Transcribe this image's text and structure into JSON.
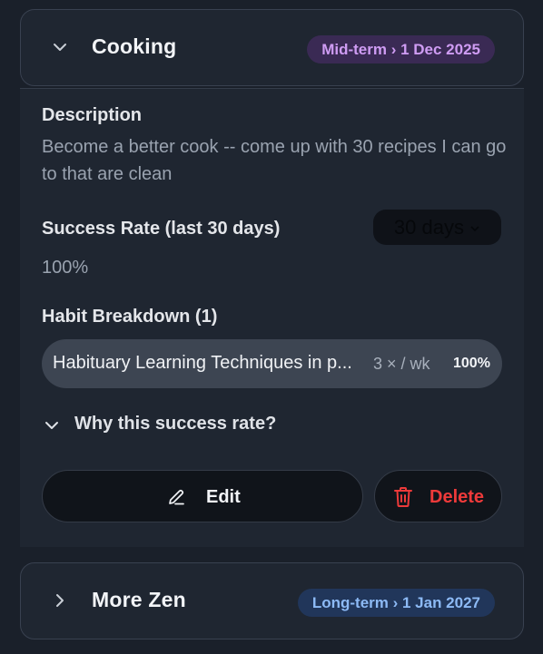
{
  "goals": [
    {
      "title": "Cooking",
      "expanded": true,
      "badge": "Mid-term › 1 Dec 2025",
      "description_label": "Description",
      "description": "Become a better cook -- come up with 30 recipes I can go to that are clean",
      "success_rate_label": "Success Rate (last 30 days)",
      "range_select": "30 days",
      "success_rate": "100%",
      "habit_breakdown_label": "Habit Breakdown (1)",
      "habits": [
        {
          "name": "Habituary Learning Techniques in p...",
          "frequency": "3 × / wk",
          "rate": "100%"
        }
      ],
      "why_label": "Why this success rate?",
      "edit_label": "Edit",
      "delete_label": "Delete"
    },
    {
      "title": "More Zen",
      "expanded": false,
      "badge": "Long-term › 1 Jan 2027"
    }
  ]
}
